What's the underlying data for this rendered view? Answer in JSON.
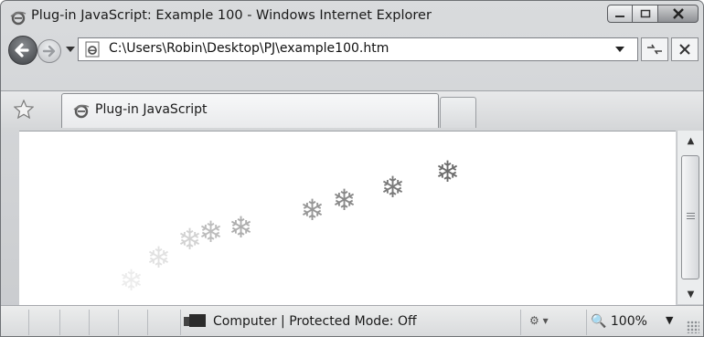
{
  "window": {
    "title": "Plug-in JavaScript: Example 100 - Windows Internet Explorer",
    "caption_buttons": {
      "minimize": "minimize-icon",
      "maximize": "maximize-icon",
      "close": "close-icon"
    }
  },
  "nav": {
    "address": "C:\\Users\\Robin\\Desktop\\PJ\\example100.htm",
    "back_icon": "back-arrow-icon",
    "forward_icon": "forward-arrow-icon",
    "refresh_icon": "refresh-icon",
    "stop_icon": "stop-icon"
  },
  "tabs": [
    {
      "label": "Plug-in JavaScript",
      "icon": "ie-page-icon",
      "active": true
    }
  ],
  "content": {
    "snowflake_glyph": "❄",
    "snowflakes": [
      {
        "opacity": 0.12
      },
      {
        "opacity": 0.2
      },
      {
        "opacity": 0.3
      },
      {
        "opacity": 0.45
      },
      {
        "opacity": 0.55
      },
      {
        "opacity": 0.7
      },
      {
        "opacity": 0.8
      },
      {
        "opacity": 0.9
      },
      {
        "opacity": 1.0
      }
    ]
  },
  "status": {
    "zone": "Computer | Protected Mode: Off",
    "zoom": "100%",
    "colors": {
      "accent": "#6c6c6c"
    }
  }
}
